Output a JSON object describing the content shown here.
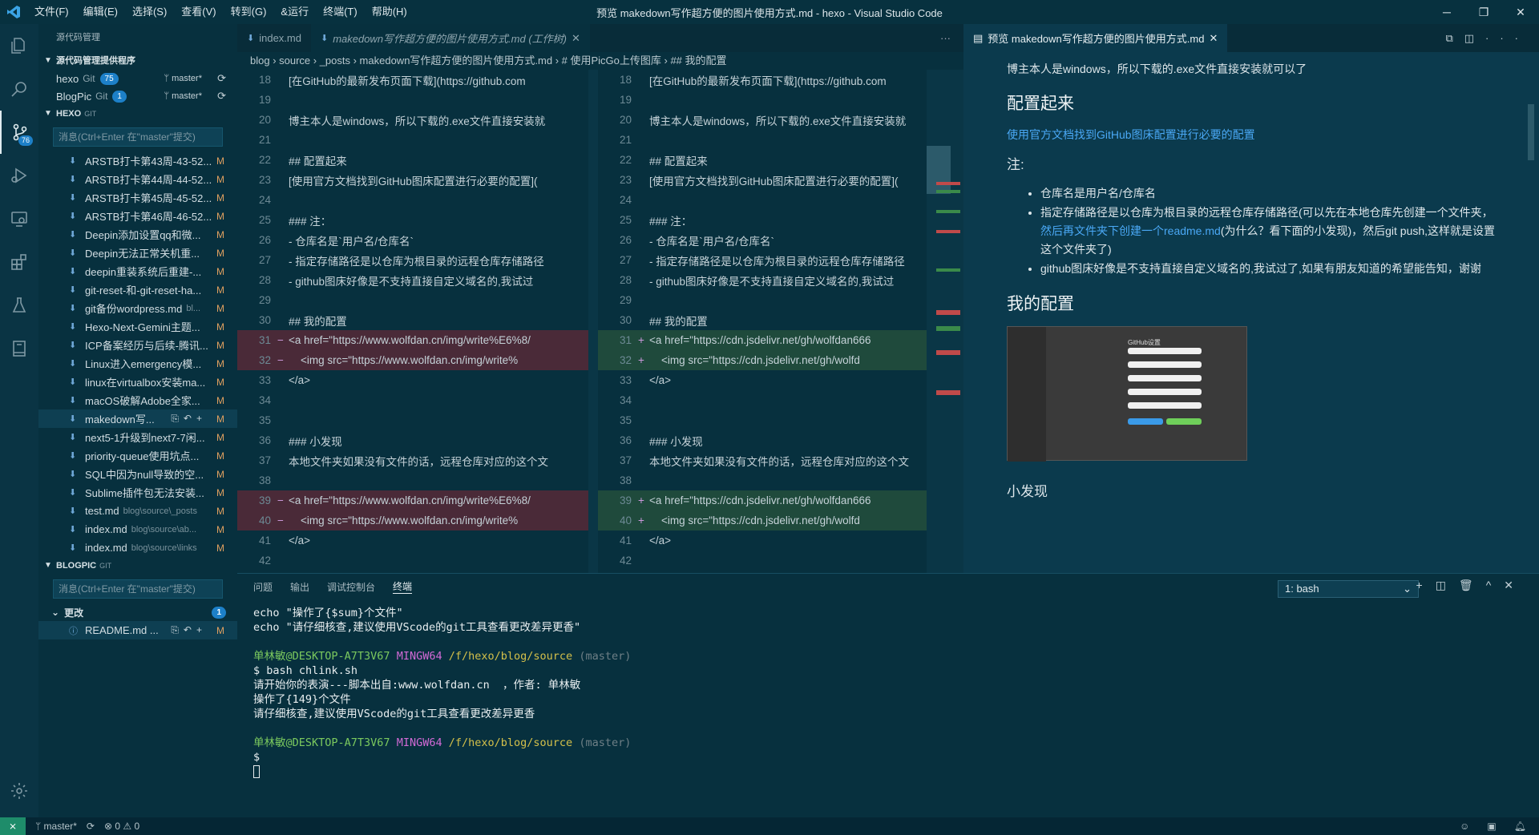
{
  "titlebar": {
    "menu": [
      "文件(F)",
      "编辑(E)",
      "选择(S)",
      "查看(V)",
      "转到(G)",
      "&运行",
      "终端(T)",
      "帮助(H)"
    ],
    "title": "预览 makedown写作超方便的图片使用方式.md - hexo - Visual Studio Code"
  },
  "activity": {
    "badge": "76"
  },
  "sidebar": {
    "title": "源代码管理",
    "providers_title": "源代码管理提供程序",
    "repos": [
      {
        "name": "hexo",
        "kind": "Git",
        "count": "75",
        "branch": "master*"
      },
      {
        "name": "BlogPic",
        "kind": "Git",
        "count": "1",
        "branch": "master*"
      }
    ],
    "hexo": {
      "title": "HEXO",
      "tag": "GIT",
      "placeholder": "消息(Ctrl+Enter 在\"master\"提交)"
    },
    "files": [
      {
        "name": "ARSTB打卡第43周-43-52...",
        "dir": "",
        "status": "M"
      },
      {
        "name": "ARSTB打卡第44周-44-52...",
        "dir": "",
        "status": "M"
      },
      {
        "name": "ARSTB打卡第45周-45-52...",
        "dir": "",
        "status": "M"
      },
      {
        "name": "ARSTB打卡第46周-46-52...",
        "dir": "",
        "status": "M"
      },
      {
        "name": "Deepin添加设置qq和微...",
        "dir": "",
        "status": "M"
      },
      {
        "name": "Deepin无法正常关机重...",
        "dir": "",
        "status": "M"
      },
      {
        "name": "deepin重装系统后重建-...",
        "dir": "",
        "status": "M"
      },
      {
        "name": "git-reset-和-git-reset-ha...",
        "dir": "",
        "status": "M"
      },
      {
        "name": "git备份wordpress.md",
        "dir": "bl...",
        "status": "M"
      },
      {
        "name": "Hexo-Next-Gemini主题...",
        "dir": "",
        "status": "M"
      },
      {
        "name": "ICP备案经历与后续-腾讯...",
        "dir": "",
        "status": "M"
      },
      {
        "name": "Linux进入emergency模...",
        "dir": "",
        "status": "M"
      },
      {
        "name": "linux在virtualbox安装ma...",
        "dir": "",
        "status": "M"
      },
      {
        "name": "macOS破解Adobe全家...",
        "dir": "",
        "status": "M"
      },
      {
        "name": "makedown写...",
        "dir": "",
        "status": "M"
      },
      {
        "name": "next5-1升级到next7-7闲...",
        "dir": "",
        "status": "M"
      },
      {
        "name": "priority-queue使用坑点...",
        "dir": "",
        "status": "M"
      },
      {
        "name": "SQL中因为null导致的空...",
        "dir": "",
        "status": "M"
      },
      {
        "name": "Sublime插件包无法安装...",
        "dir": "",
        "status": "M"
      },
      {
        "name": "test.md",
        "dir": "blog\\source\\_posts",
        "status": "M"
      },
      {
        "name": "index.md",
        "dir": "blog\\source\\ab...",
        "status": "M"
      },
      {
        "name": "index.md",
        "dir": "blog\\source\\links",
        "status": "M"
      }
    ],
    "blogpic": {
      "title": "BLOGPIC",
      "tag": "GIT",
      "placeholder": "消息(Ctrl+Enter 在\"master\"提交)",
      "changes": "更改",
      "changes_count": "1",
      "file": "README.md ...",
      "status": "M"
    }
  },
  "editor": {
    "tabs": [
      "index.md",
      "makedown写作超方便的图片使用方式.md (工作树)"
    ],
    "breadcrumb": "blog › source › _posts › makedown写作超方便的图片使用方式.md › # 使用PicGo上传图库 › ## 我的配置",
    "left": [
      {
        "n": "18",
        "m": "",
        "t": "[在GitHub的最新发布页面下载](https://github.com",
        "c": "k-tx"
      },
      {
        "n": "19",
        "m": "",
        "t": "",
        "c": "k-tx"
      },
      {
        "n": "20",
        "m": "",
        "t": "博主本人是windows，所以下载的.exe文件直接安装就",
        "c": "k-tx"
      },
      {
        "n": "21",
        "m": "",
        "t": "",
        "c": "k-tx"
      },
      {
        "n": "22",
        "m": "",
        "t": "## 配置起来",
        "c": "k-h"
      },
      {
        "n": "23",
        "m": "",
        "t": "[使用官方文档找到GitHub图床配置进行必要的配置](",
        "c": "k-tx"
      },
      {
        "n": "24",
        "m": "",
        "t": "",
        "c": "k-tx"
      },
      {
        "n": "25",
        "m": "",
        "t": "### 注：",
        "c": "k-h"
      },
      {
        "n": "26",
        "m": "",
        "t": "- 仓库名是`用户名/仓库名`",
        "c": "k-h"
      },
      {
        "n": "27",
        "m": "",
        "t": "- 指定存储路径是以仓库为根目录的远程仓库存储路径",
        "c": "k-h"
      },
      {
        "n": "28",
        "m": "",
        "t": "- github图床好像是不支持直接自定义域名的,我试过",
        "c": "k-h"
      },
      {
        "n": "29",
        "m": "",
        "t": "",
        "c": "k-tx"
      },
      {
        "n": "30",
        "m": "",
        "t": "## 我的配置",
        "c": "k-h"
      },
      {
        "n": "31",
        "m": "−",
        "t": "<a href=\"https://www.wolfdan.cn/img/write%E6%8/",
        "c": "del"
      },
      {
        "n": "32",
        "m": "−",
        "t": "    <img src=\"https://www.wolfdan.cn/img/write%",
        "c": "del2"
      },
      {
        "n": "33",
        "m": "",
        "t": "</a>",
        "c": "k-tag"
      },
      {
        "n": "34",
        "m": "",
        "t": "",
        "c": "k-tx"
      },
      {
        "n": "35",
        "m": "",
        "t": "",
        "c": "k-tx"
      },
      {
        "n": "36",
        "m": "",
        "t": "### 小发现",
        "c": "k-h"
      },
      {
        "n": "37",
        "m": "",
        "t": "本地文件夹如果没有文件的话，远程仓库对应的这个文",
        "c": "k-tx"
      },
      {
        "n": "38",
        "m": "",
        "t": "",
        "c": "k-tx"
      },
      {
        "n": "39",
        "m": "−",
        "t": "<a href=\"https://www.wolfdan.cn/img/write%E6%8/",
        "c": "del"
      },
      {
        "n": "40",
        "m": "−",
        "t": "    <img src=\"https://www.wolfdan.cn/img/write%",
        "c": "del2"
      },
      {
        "n": "41",
        "m": "",
        "t": "</a>",
        "c": "k-tag"
      },
      {
        "n": "42",
        "m": "",
        "t": "",
        "c": "k-tx"
      }
    ],
    "right": [
      {
        "n": "18",
        "m": "",
        "t": "[在GitHub的最新发布页面下载](https://github.com",
        "c": "k-tx"
      },
      {
        "n": "19",
        "m": "",
        "t": "",
        "c": "k-tx"
      },
      {
        "n": "20",
        "m": "",
        "t": "博主本人是windows，所以下载的.exe文件直接安装就",
        "c": "k-tx"
      },
      {
        "n": "21",
        "m": "",
        "t": "",
        "c": "k-tx"
      },
      {
        "n": "22",
        "m": "",
        "t": "## 配置起来",
        "c": "k-h"
      },
      {
        "n": "23",
        "m": "",
        "t": "[使用官方文档找到GitHub图床配置进行必要的配置](",
        "c": "k-tx"
      },
      {
        "n": "24",
        "m": "",
        "t": "",
        "c": "k-tx"
      },
      {
        "n": "25",
        "m": "",
        "t": "### 注：",
        "c": "k-h"
      },
      {
        "n": "26",
        "m": "",
        "t": "- 仓库名是`用户名/仓库名`",
        "c": "k-h"
      },
      {
        "n": "27",
        "m": "",
        "t": "- 指定存储路径是以仓库为根目录的远程仓库存储路径",
        "c": "k-h"
      },
      {
        "n": "28",
        "m": "",
        "t": "- github图床好像是不支持直接自定义域名的,我试过",
        "c": "k-h"
      },
      {
        "n": "29",
        "m": "",
        "t": "",
        "c": "k-tx"
      },
      {
        "n": "30",
        "m": "",
        "t": "## 我的配置",
        "c": "k-h"
      },
      {
        "n": "31",
        "m": "+",
        "t": "<a href=\"https://cdn.jsdelivr.net/gh/wolfdan666",
        "c": "add"
      },
      {
        "n": "32",
        "m": "+",
        "t": "    <img src=\"https://cdn.jsdelivr.net/gh/wolfd",
        "c": "add2"
      },
      {
        "n": "33",
        "m": "",
        "t": "</a>",
        "c": "k-tag"
      },
      {
        "n": "34",
        "m": "",
        "t": "",
        "c": "k-tx"
      },
      {
        "n": "35",
        "m": "",
        "t": "",
        "c": "k-tx"
      },
      {
        "n": "36",
        "m": "",
        "t": "### 小发现",
        "c": "k-h"
      },
      {
        "n": "37",
        "m": "",
        "t": "本地文件夹如果没有文件的话，远程仓库对应的这个文",
        "c": "k-tx"
      },
      {
        "n": "38",
        "m": "",
        "t": "",
        "c": "k-tx"
      },
      {
        "n": "39",
        "m": "+",
        "t": "<a href=\"https://cdn.jsdelivr.net/gh/wolfdan666",
        "c": "add"
      },
      {
        "n": "40",
        "m": "+",
        "t": "    <img src=\"https://cdn.jsdelivr.net/gh/wolfd",
        "c": "add2"
      },
      {
        "n": "41",
        "m": "",
        "t": "</a>",
        "c": "k-tag"
      },
      {
        "n": "42",
        "m": "",
        "t": "",
        "c": "k-tx"
      }
    ]
  },
  "preview": {
    "tab": "预览 makedown写作超方便的图片使用方式.md",
    "p1": "博主本人是windows，所以下载的.exe文件直接安装就可以了",
    "h_config": "配置起来",
    "link": "使用官方文档找到GitHub图床配置进行必要的配置",
    "note": "注:",
    "li1": "仓库名是用户名/仓库名",
    "li2a": "指定存储路径是以仓库为根目录的远程仓库存储路径(可以先在本地仓库先创建一个文件夹，",
    "li2link": "然后再文件夹下创建一个readme.md",
    "li2b": "(为什么？看下面的小发现)，然后git push,这样就是设置这个文件夹了)",
    "li3": "github图床好像是不支持直接自定义域名的,我试过了,如果有朋友知道的希望能告知，谢谢",
    "h_mine": "我的配置",
    "img_title": "GitHub设置",
    "h_found": "小发现"
  },
  "panel": {
    "tabs": [
      "问题",
      "输出",
      "调试控制台",
      "终端"
    ],
    "terminal_select": "1: bash"
  },
  "terminal": {
    "l1": "echo \"操作了{$sum}个文件\"",
    "l2": "echo \"请仔细核查,建议使用VScode的git工具查看更改差异更香\"",
    "user": "单林敏@DESKTOP-A7T3V67",
    "env": "MINGW64",
    "path": "/f/hexo/blog/source",
    "branch": "(master)",
    "cmd": "$ bash chlink.sh",
    "o1": "请开始你的表演---脚本出自:www.wolfdan.cn  ，作者: 单林敏",
    "o2": "操作了{149}个文件",
    "o3": "请仔细核查,建议使用VScode的git工具查看更改差异更香",
    "prompt": "$"
  },
  "status": {
    "branch": "master*",
    "problems": "⊗ 0 ⚠ 0"
  }
}
